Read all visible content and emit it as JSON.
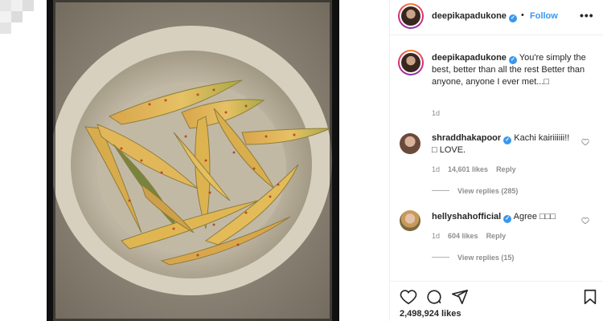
{
  "post": {
    "username": "deepikapadukone",
    "follow_label": "Follow",
    "more_label": "•••",
    "caption_text": "You're simply the best, better than all the rest Better than anyone, anyone I ever met...□",
    "caption_age": "1d",
    "likes_count": "2,498,924 likes"
  },
  "comments": [
    {
      "username": "shraddhakapoor",
      "text": "Kachi kairiiiiii!! □ LOVE.",
      "age": "1d",
      "likes": "14,601 likes",
      "reply_label": "Reply",
      "view_replies": "View replies (285)"
    },
    {
      "username": "hellyshahofficial",
      "text": "Agree □□□",
      "age": "1d",
      "likes": "604 likes",
      "reply_label": "Reply",
      "view_replies": "View replies (15)"
    }
  ],
  "icons": {
    "like": "heart-icon",
    "comment": "comment-icon",
    "share": "paper-plane-icon",
    "save": "bookmark-icon",
    "verified": "verified-badge-icon"
  },
  "colors": {
    "accent": "#3897f0",
    "text": "#262626",
    "muted": "#8e8e8e",
    "border": "#efefef"
  }
}
